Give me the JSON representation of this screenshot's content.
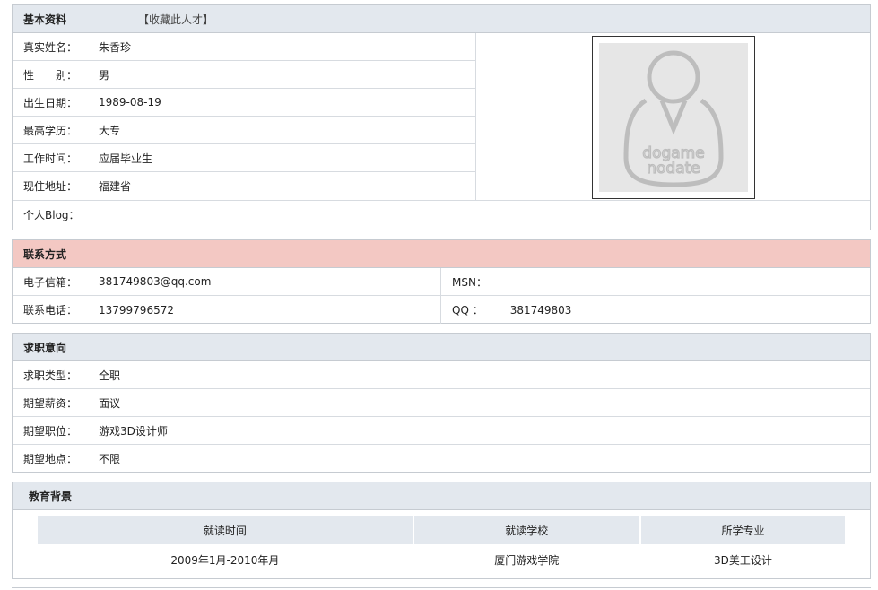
{
  "basic": {
    "title": "基本资料",
    "favorite": "【收藏此人才】",
    "rows": [
      {
        "label": "真实姓名：",
        "value": "朱香珍"
      },
      {
        "label": "性　　别：",
        "value": "男"
      },
      {
        "label": "出生日期：",
        "value": "1989-08-19"
      },
      {
        "label": "最高学历：",
        "value": "大专"
      },
      {
        "label": "工作时间：",
        "value": "应届毕业生"
      },
      {
        "label": "现住地址：",
        "value": "福建省"
      }
    ],
    "blog_label": "个人Blog：",
    "blog_value": "",
    "photo_text": [
      "dogame",
      "nodate"
    ]
  },
  "contact": {
    "title": "联系方式",
    "email_label": "电子信箱：",
    "email_value": "381749803@qq.com",
    "msn_label": "MSN：",
    "msn_value": "",
    "phone_label": "联系电话：",
    "phone_value": "13799796572",
    "qq_label": "QQ ：",
    "qq_value": "381749803"
  },
  "job": {
    "title": "求职意向",
    "rows": [
      {
        "label": "求职类型：",
        "value": "全职"
      },
      {
        "label": "期望薪资：",
        "value": "面议"
      },
      {
        "label": "期望职位：",
        "value": "游戏3D设计师"
      },
      {
        "label": "期望地点：",
        "value": "不限"
      }
    ]
  },
  "education": {
    "title": "教育背景",
    "headers": [
      "就读时间",
      "就读学校",
      "所学专业"
    ],
    "rows": [
      [
        "2009年1月-2010年月",
        "厦门游戏学院",
        "3D美工设计"
      ]
    ]
  },
  "colors": {
    "header_gray": "#e3e8ee",
    "header_pink": "#f3c8c3",
    "border": "#c6cbd1"
  }
}
